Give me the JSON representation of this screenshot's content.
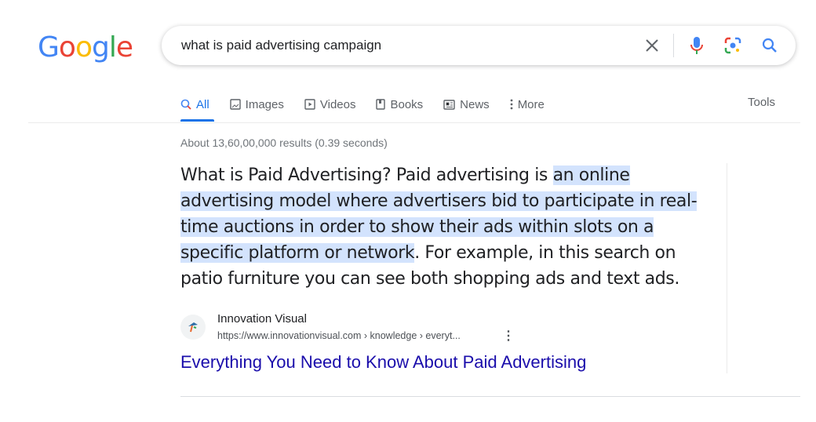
{
  "logo": {
    "letters": [
      "G",
      "o",
      "o",
      "g",
      "l",
      "e"
    ],
    "colors": [
      "#4285f4",
      "#ea4335",
      "#fbbc05",
      "#4285f4",
      "#34a853",
      "#ea4335"
    ]
  },
  "search": {
    "query": "what is paid advertising campaign"
  },
  "tabs": [
    {
      "label": "All",
      "icon": "search-icon"
    },
    {
      "label": "Images",
      "icon": "image-icon"
    },
    {
      "label": "Videos",
      "icon": "play-icon"
    },
    {
      "label": "Books",
      "icon": "book-icon"
    },
    {
      "label": "News",
      "icon": "news-icon"
    },
    {
      "label": "More",
      "icon": "more-vert-icon"
    }
  ],
  "tools_label": "Tools",
  "stats": "About 13,60,00,000 results (0.39 seconds)",
  "snippet": {
    "lines": [
      [
        {
          "t": "What is Paid Advertising? Paid advertising is ",
          "h": false
        },
        {
          "t": "an online",
          "h": true
        }
      ],
      [
        {
          "t": "advertising model where advertisers bid to participate in real-",
          "h": true
        }
      ],
      [
        {
          "t": "time auctions in order to show their ads within slots on a",
          "h": true
        }
      ],
      [
        {
          "t": "specific platform or network",
          "h": true
        },
        {
          "t": ". For example, in this search on",
          "h": false
        }
      ],
      [
        {
          "t": "patio furniture you can see both shopping ads and text ads.",
          "h": false
        }
      ]
    ]
  },
  "result": {
    "site": "Innovation Visual",
    "url": "https://www.innovationvisual.com › knowledge › everyt...",
    "title": "Everything You Need to Know About Paid Advertising"
  },
  "colors": {
    "link": "#1a0dab",
    "accent": "#1a73e8",
    "highlight": "#d3e3fd"
  }
}
